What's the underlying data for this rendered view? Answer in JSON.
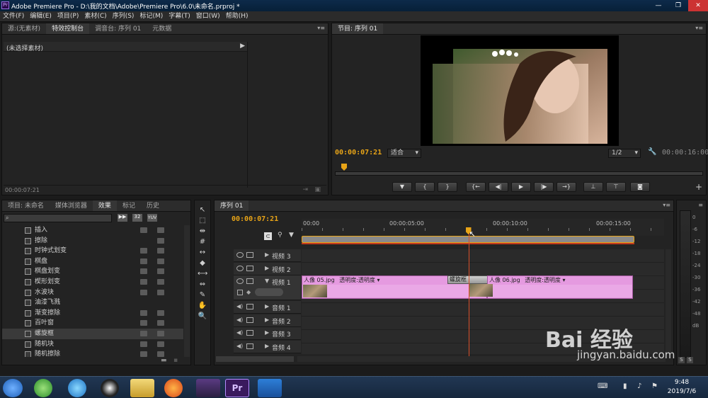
{
  "window": {
    "title": "Adobe Premiere Pro - D:\\我的文档\\Adobe\\Premiere Pro\\6.0\\未命名.prproj *",
    "app_icon": "Pr"
  },
  "window_controls": [
    "—",
    "❐",
    "✕"
  ],
  "menu": [
    "文件(F)",
    "编辑(E)",
    "项目(P)",
    "素材(C)",
    "序列(S)",
    "标记(M)",
    "字幕(T)",
    "窗口(W)",
    "帮助(H)"
  ],
  "source_panel": {
    "tabs": [
      "源:(无素材)",
      "特效控制台",
      "调音台: 序列 01",
      "元数据"
    ],
    "active_tab": 1,
    "header": "(未选择素材)",
    "timecode": "00:00:07:21"
  },
  "program_monitor": {
    "tab": "节目: 序列 01",
    "timecode": "00:00:07:21",
    "fit": "适合",
    "resolution": "1/2",
    "duration": "00:00:16:00",
    "playhead_fraction": 0.3
  },
  "project_panel": {
    "tabs": [
      "项目: 未命名",
      "媒体浏览器",
      "效果",
      "标记",
      "历史"
    ],
    "active_tab": 2,
    "effects": [
      "插入",
      "擦除",
      "时钟式划变",
      "棋盘",
      "棋盘划变",
      "楔形划变",
      "水波块",
      "油漆飞溅",
      "渐变擦除",
      "百叶窗",
      "螺旋框",
      "随机块",
      "随机擦除"
    ],
    "selected_effect": "螺旋框",
    "icon_labels": [
      "32",
      "YUV"
    ]
  },
  "tools": [
    "selection-tool-icon",
    "track-select-tool-icon",
    "ripple-edit-tool-icon",
    "rolling-edit-tool-icon",
    "rate-stretch-tool-icon",
    "razor-tool-icon",
    "slip-tool-icon",
    "slide-tool-icon",
    "pen-tool-icon",
    "hand-tool-icon",
    "zoom-tool-icon"
  ],
  "timeline": {
    "tab": "序列 01",
    "timecode": "00:00:07:21",
    "ruler": [
      "00:00",
      "00:00:05:00",
      "00:00:10:00",
      "00:00:15:00"
    ],
    "video_tracks": [
      "视频 3",
      "视频 2",
      "视频 1"
    ],
    "audio_tracks": [
      "音频 1",
      "音频 2",
      "音频 3",
      "音频 4"
    ],
    "clips": [
      {
        "name": "人像 05.jpg",
        "label": "透明度:透明度"
      },
      {
        "name": "人像 06.jpg",
        "label": "透明度:透明度"
      }
    ],
    "transition": "螺旋框",
    "playhead_fraction": 0.46
  },
  "audio_meter": {
    "scale": [
      "0",
      "-6",
      "-12",
      "-18",
      "-24",
      "-30",
      "-36",
      "-42",
      "-48",
      "dB"
    ],
    "solo": [
      "S",
      "S"
    ]
  },
  "taskbar": {
    "time": "9:48",
    "date": "2019/7/6"
  },
  "watermark": {
    "brand": "Bai 经验",
    "url": "jingyan.baidu.com"
  }
}
